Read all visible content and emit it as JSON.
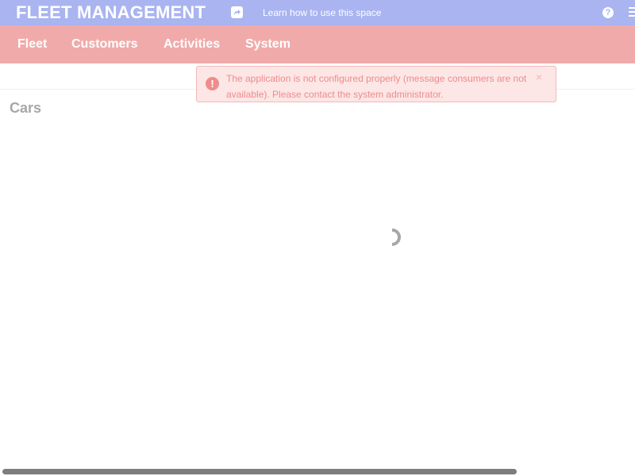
{
  "header": {
    "app_title": "FLEET MANAGEMENT",
    "learn_link": "Learn how to use this space",
    "help_icon": "?",
    "share_icon": "share-icon",
    "menu_icon": "hamburger-menu-icon"
  },
  "nav": {
    "items": [
      {
        "label": "Fleet"
      },
      {
        "label": "Customers"
      },
      {
        "label": "Activities"
      },
      {
        "label": "System"
      }
    ]
  },
  "alert": {
    "icon": "!",
    "message": "The application is not configured properly (message consumers are not available). Please contact the system administrator.",
    "close": "×"
  },
  "main": {
    "page_title": "Cars"
  },
  "colors": {
    "topbar": "#a9b4f0",
    "navbar": "#f1aaaa",
    "alert_bg": "#fde6e6",
    "alert_text": "#ee8b8b"
  }
}
